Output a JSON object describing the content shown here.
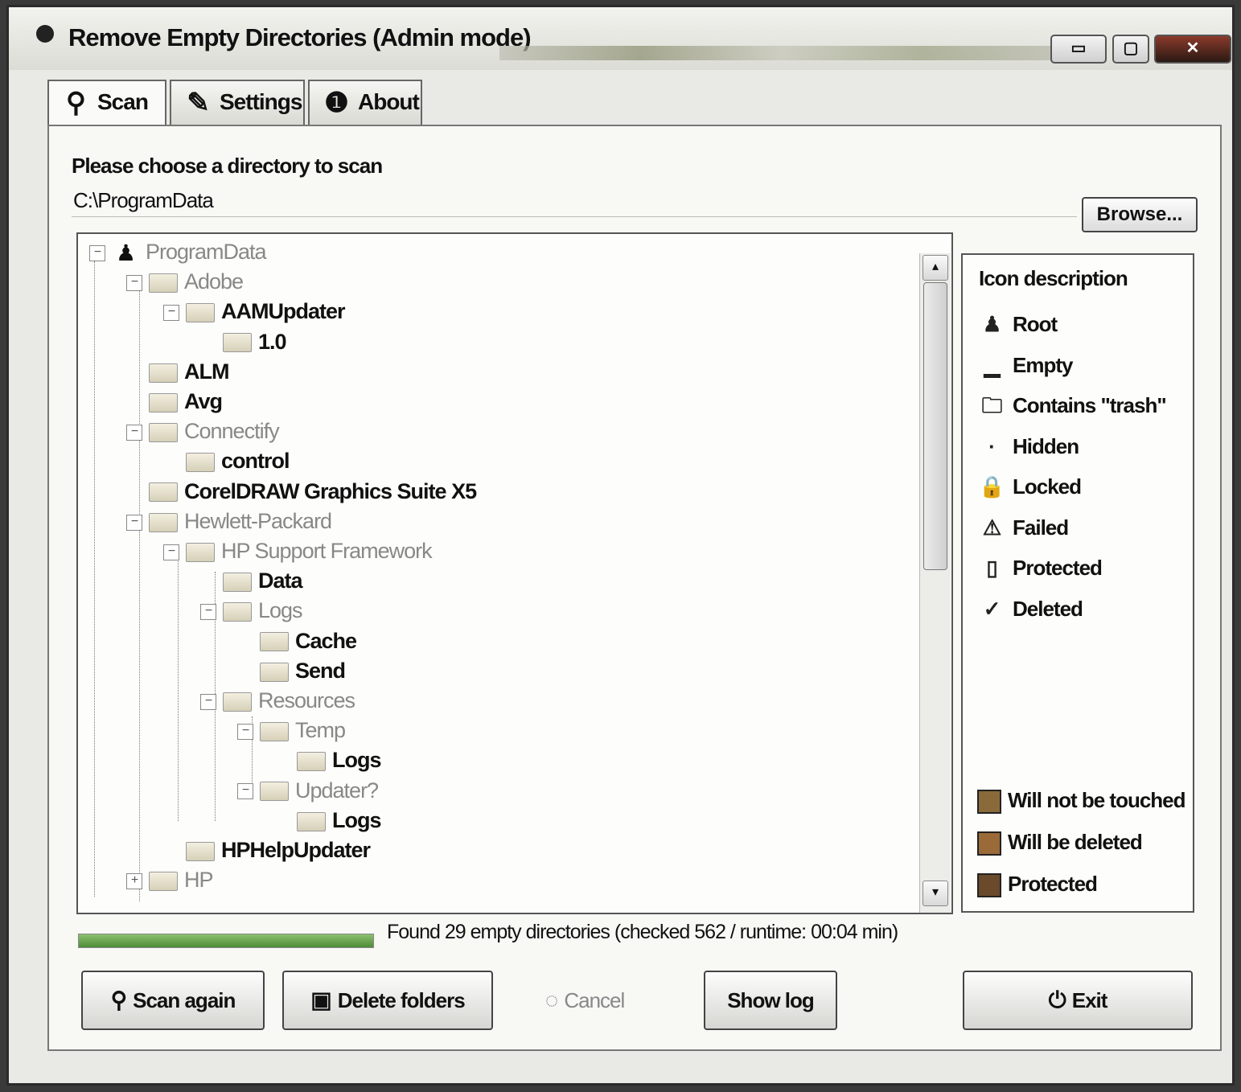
{
  "window": {
    "title": "Remove Empty Directories (Admin mode)",
    "buttons": {
      "minimize": "▭",
      "maximize": "▢",
      "close": "✕"
    }
  },
  "tabs": [
    {
      "label": "Scan",
      "icon": "search-icon"
    },
    {
      "label": "Settings",
      "icon": "settings-icon"
    },
    {
      "label": "About",
      "icon": "info-icon"
    }
  ],
  "scan": {
    "choose_label": "Please choose a directory to scan",
    "directory": "C:\\ProgramData",
    "browse_label": "Browse..."
  },
  "tree": {
    "nodes": [
      {
        "label": "ProgramData",
        "style": "dim",
        "icon": "root-icon"
      },
      {
        "label": "Adobe",
        "style": "dim",
        "icon": "folder-icon"
      },
      {
        "label": "AAMUpdater",
        "style": "bold",
        "icon": "folder-icon"
      },
      {
        "label": "1.0",
        "style": "bold",
        "icon": "folder-icon"
      },
      {
        "label": "ALM",
        "style": "bold",
        "icon": "folder-icon"
      },
      {
        "label": "Avg",
        "style": "bold",
        "icon": "folder-icon"
      },
      {
        "label": "Connectify",
        "style": "dim",
        "icon": "folder-icon"
      },
      {
        "label": "control",
        "style": "bold",
        "icon": "folder-icon"
      },
      {
        "label": "CorelDRAW Graphics Suite X5",
        "style": "bold",
        "icon": "folder-icon"
      },
      {
        "label": "Hewlett-Packard",
        "style": "dim",
        "icon": "folder-icon"
      },
      {
        "label": "HP Support Framework",
        "style": "dim",
        "icon": "folder-icon"
      },
      {
        "label": "Data",
        "style": "bold",
        "icon": "folder-icon"
      },
      {
        "label": "Logs",
        "style": "dim",
        "icon": "folder-icon"
      },
      {
        "label": "Cache",
        "style": "bold",
        "icon": "folder-icon"
      },
      {
        "label": "Send",
        "style": "bold",
        "icon": "folder-icon"
      },
      {
        "label": "Resources",
        "style": "dim",
        "icon": "folder-icon"
      },
      {
        "label": "Temp",
        "style": "dim",
        "icon": "folder-icon"
      },
      {
        "label": "Logs",
        "style": "bold",
        "icon": "folder-icon"
      },
      {
        "label": "Updater?",
        "style": "dim",
        "icon": "folder-icon"
      },
      {
        "label": "Logs",
        "style": "bold",
        "icon": "folder-icon"
      },
      {
        "label": "HPHelpUpdater",
        "style": "bold",
        "icon": "folder-icon"
      },
      {
        "label": "HP",
        "style": "dim",
        "icon": "folder-icon"
      }
    ]
  },
  "legend": {
    "title": "Icon description",
    "items": [
      {
        "label": "Root",
        "icon": "root-icon",
        "glyph": "♟"
      },
      {
        "label": "Empty",
        "icon": "empty-folder-icon",
        "glyph": "▁"
      },
      {
        "label": "Contains \"trash\"",
        "icon": "trash-folder-icon",
        "glyph": "🗀"
      },
      {
        "label": "Hidden",
        "icon": "hidden-icon",
        "glyph": "·"
      },
      {
        "label": "Locked",
        "icon": "locked-icon",
        "glyph": "🔒"
      },
      {
        "label": "Failed",
        "icon": "warning-icon",
        "glyph": "⚠"
      },
      {
        "label": "Protected",
        "icon": "protected-icon",
        "glyph": "▯"
      },
      {
        "label": "Deleted",
        "icon": "check-icon",
        "glyph": "✓"
      }
    ],
    "colors": [
      {
        "label": "Will not be touched",
        "color": "#8a6a3a"
      },
      {
        "label": "Will be deleted",
        "color": "#9a6a38"
      },
      {
        "label": "Protected",
        "color": "#6a4a2a"
      }
    ]
  },
  "status": {
    "text": "Found 29 empty directories (checked 562 / runtime: 00:04 min)",
    "progress": 1.0
  },
  "actions": {
    "scan_again": "Scan again",
    "delete_folders": "Delete folders",
    "cancel": "Cancel",
    "show_log": "Show log",
    "exit": "Exit"
  }
}
